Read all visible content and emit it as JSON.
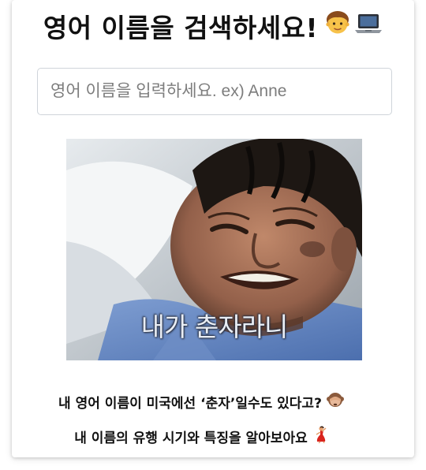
{
  "header": {
    "title": "영어 이름을 검색하세요!",
    "icons": [
      "boy-emoji-icon",
      "laptop-emoji-icon"
    ]
  },
  "search": {
    "placeholder": "영어 이름을 입력하세요. ex) Anne",
    "value": ""
  },
  "meme": {
    "subtitle": "내가 춘자라니"
  },
  "captions": {
    "line1": "내 영어 이름이 미국에선 ‘춘자’일수도 있다고?",
    "line1_icon": "see-no-evil-monkey-icon",
    "line2": "내 이름의 유행 시기와 특징을 알아보아요",
    "line2_icon": "dancer-icon"
  }
}
